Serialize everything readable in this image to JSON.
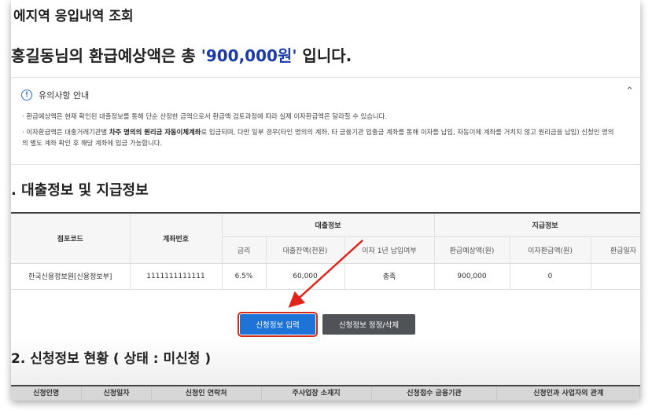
{
  "page": {
    "top_title": "에지역 응입내역 조회",
    "headline_prefix": "홍길동님의 환급예상액은 총 ",
    "headline_amount": "'900,000원'",
    "headline_suffix": " 입니다."
  },
  "notice": {
    "title": "유의사항 안내",
    "line1": "· 환급예상액은 현재 확인된 대출정보를 통해 단순 산정한 금액으로서 환급액 검토과정에 따라 실제 이자환급액은 달라질 수 있습니다.",
    "line2_pre": "· 이자환급액은 대출거래기관별 ",
    "line2_bold": "차주 명의의 원리금 자동이체계좌",
    "line2_post": "로 입금되며, 다만 일부 경우(타인 명의의 계좌, 타 금융기관 입출금 계좌를 통해 이자를 납입, 자동이체 계좌를 거치지 않고 원리금을 납입) 신청인 명의",
    "line3": "의 별도 계좌 확인 후 해당 계좌에 입금 가능합니다."
  },
  "section1": {
    "title": ". 대출정보 및 지급정보"
  },
  "loan_table": {
    "headers": {
      "branch_code": "점포코드",
      "account_no": "계좌번호",
      "loan_info": "대출정보",
      "payment_info": "지급정보",
      "rate": "금리",
      "balance": "대출잔액(천원)",
      "interest_1yr": "이자 1년 납입여부",
      "expected_refund": "환급예상액(원)",
      "interest_refund": "이자환급액(원)",
      "refund_date": "환급일자"
    },
    "rows": [
      {
        "branch_code": "한국신용정보원[신용정보부]",
        "account_no": "1111111111111",
        "rate": "6.5%",
        "balance": "60,000",
        "interest_1yr": "충족",
        "expected_refund": "900,000",
        "interest_refund": "0",
        "refund_date": ""
      }
    ]
  },
  "buttons": {
    "apply_input": "신청정보 입력",
    "apply_edit": "신청정보 정정/삭제"
  },
  "section2": {
    "title": "2. 신청정보 현황 ( 상태 : 미신청 )"
  },
  "apply_table_headers": [
    "신청인명",
    "신청일자",
    "신청인 연락처",
    "주사업장 소재지",
    "신청접수 금융기관",
    "신청인과 사업자의 관계"
  ],
  "colors": {
    "accent": "#1e73d7",
    "highlight": "#d42a1a",
    "amount": "#1a3aa8"
  }
}
